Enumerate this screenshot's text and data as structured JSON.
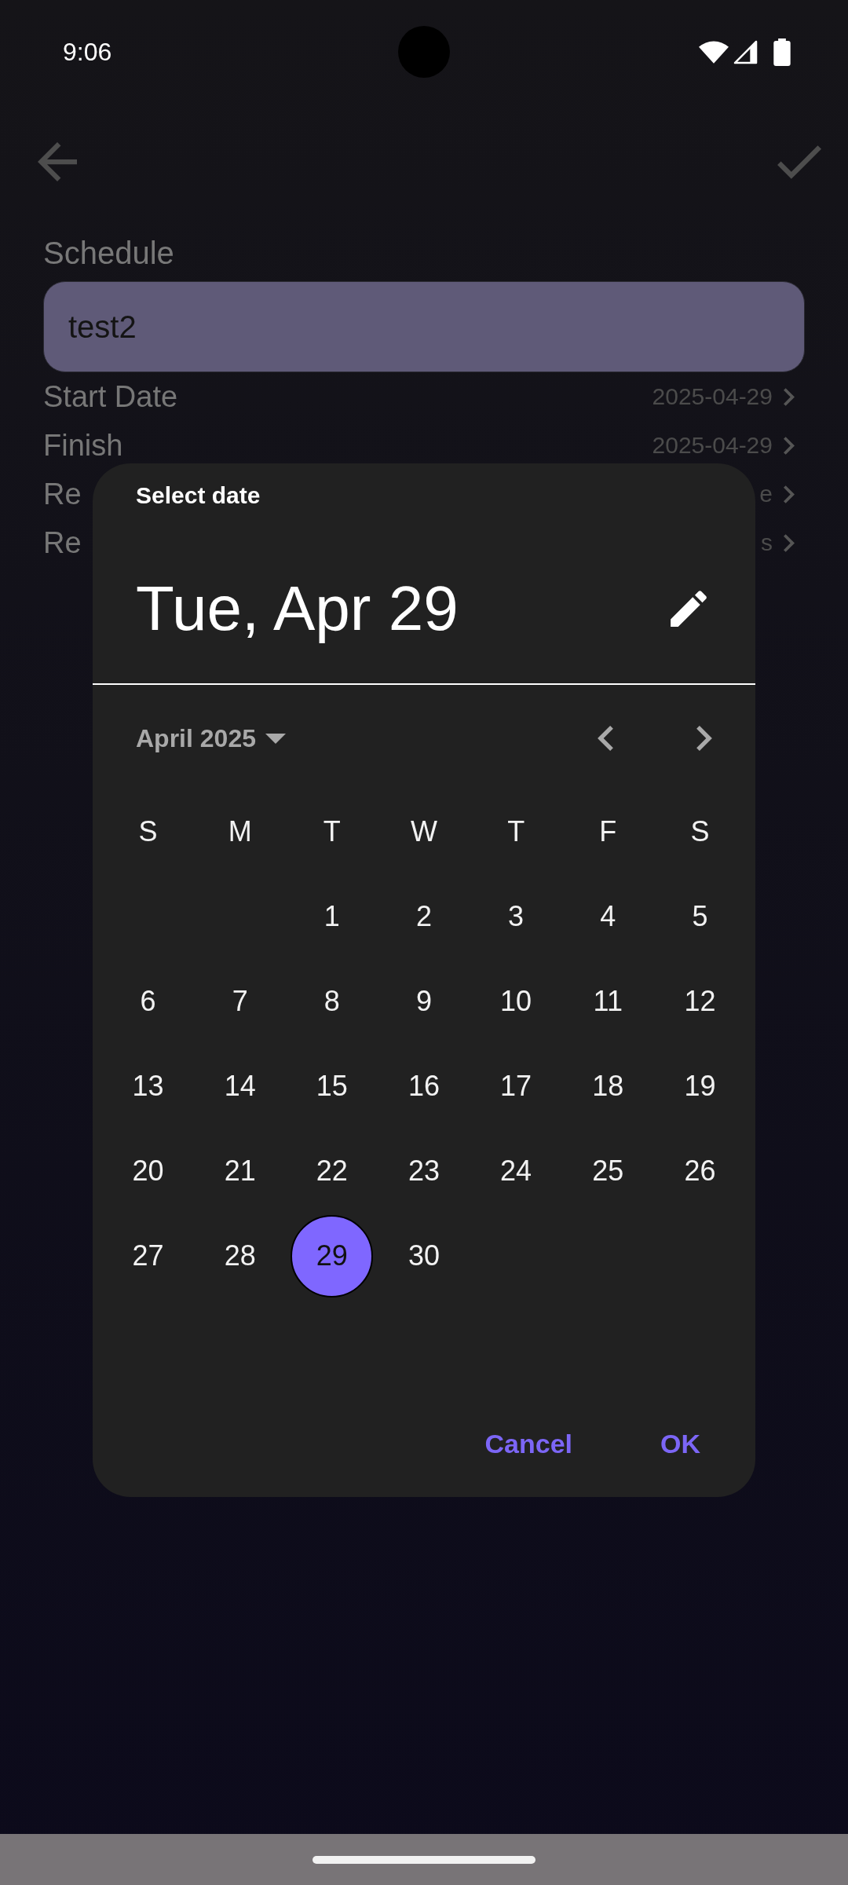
{
  "status_bar": {
    "time": "9:06"
  },
  "form": {
    "name_label": "Schedule",
    "name_field": {
      "value": "test2"
    },
    "rows": [
      {
        "label": "Start Date",
        "value": "2025-04-29"
      },
      {
        "label": "Finish",
        "value": "2025-04-29"
      },
      {
        "label": "Re",
        "value": "e"
      },
      {
        "label": "Re",
        "value": "s"
      }
    ]
  },
  "dialog": {
    "title": "Select date",
    "selected_date": "Tue, Apr 29",
    "month_label": "April 2025",
    "weekdays": [
      "S",
      "M",
      "T",
      "W",
      "T",
      "F",
      "S"
    ],
    "weeks": [
      [
        {
          "kind": "empty"
        },
        {
          "kind": "empty"
        },
        {
          "kind": "date",
          "label": "1",
          "selected": false
        },
        {
          "kind": "date",
          "label": "2",
          "selected": false
        },
        {
          "kind": "date",
          "label": "3",
          "selected": false
        },
        {
          "kind": "date",
          "label": "4",
          "selected": false
        },
        {
          "kind": "date",
          "label": "5",
          "selected": false
        }
      ],
      [
        {
          "kind": "date",
          "label": "6",
          "selected": false
        },
        {
          "kind": "date",
          "label": "7",
          "selected": false
        },
        {
          "kind": "date",
          "label": "8",
          "selected": false
        },
        {
          "kind": "date",
          "label": "9",
          "selected": false
        },
        {
          "kind": "date",
          "label": "10",
          "selected": false
        },
        {
          "kind": "date",
          "label": "11",
          "selected": false
        },
        {
          "kind": "date",
          "label": "12",
          "selected": false
        }
      ],
      [
        {
          "kind": "date",
          "label": "13",
          "selected": false
        },
        {
          "kind": "date",
          "label": "14",
          "selected": false
        },
        {
          "kind": "date",
          "label": "15",
          "selected": false
        },
        {
          "kind": "date",
          "label": "16",
          "selected": false
        },
        {
          "kind": "date",
          "label": "17",
          "selected": false
        },
        {
          "kind": "date",
          "label": "18",
          "selected": false
        },
        {
          "kind": "date",
          "label": "19",
          "selected": false
        }
      ],
      [
        {
          "kind": "date",
          "label": "20",
          "selected": false
        },
        {
          "kind": "date",
          "label": "21",
          "selected": false
        },
        {
          "kind": "date",
          "label": "22",
          "selected": false
        },
        {
          "kind": "date",
          "label": "23",
          "selected": false
        },
        {
          "kind": "date",
          "label": "24",
          "selected": false
        },
        {
          "kind": "date",
          "label": "25",
          "selected": false
        },
        {
          "kind": "date",
          "label": "26",
          "selected": false
        }
      ],
      [
        {
          "kind": "date",
          "label": "27",
          "selected": false
        },
        {
          "kind": "date",
          "label": "28",
          "selected": false
        },
        {
          "kind": "date",
          "label": "29",
          "selected": true
        },
        {
          "kind": "date",
          "label": "30",
          "selected": false
        }
      ]
    ],
    "buttons": [
      "Cancel",
      "OK"
    ]
  }
}
